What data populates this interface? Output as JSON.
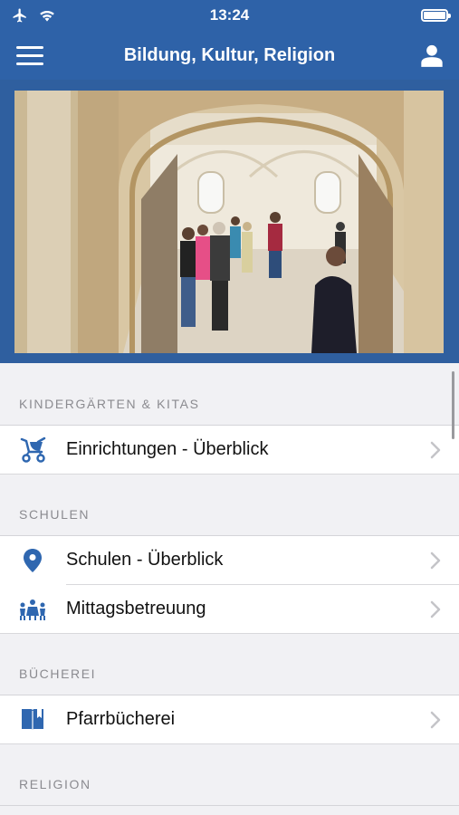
{
  "statusbar": {
    "time": "13:24",
    "icons": [
      "airplane-icon",
      "wifi-icon",
      "battery-icon"
    ]
  },
  "navbar": {
    "title": "Bildung, Kultur, Religion",
    "menu_icon": "hamburger-icon",
    "user_icon": "user-icon"
  },
  "hero": {
    "image": "photo"
  },
  "sections": [
    {
      "header": "KINDERGÄRTEN & KITAS",
      "items": [
        {
          "label": "Einrichtungen - Überblick",
          "icon": "stroller-icon"
        }
      ]
    },
    {
      "header": "SCHULEN",
      "items": [
        {
          "label": "Schulen - Überblick",
          "icon": "location-pin-icon"
        },
        {
          "label": "Mittagsbetreuung",
          "icon": "children-icon"
        }
      ]
    },
    {
      "header": "BÜCHEREI",
      "items": [
        {
          "label": "Pfarrbücherei",
          "icon": "book-icon"
        }
      ]
    },
    {
      "header": "RELIGION",
      "items": []
    }
  ],
  "colors": {
    "accent": "#2e62a8",
    "icon_blue": "#2f67b0",
    "section_text": "#8b8b90",
    "chevron": "#c4c4c8"
  }
}
